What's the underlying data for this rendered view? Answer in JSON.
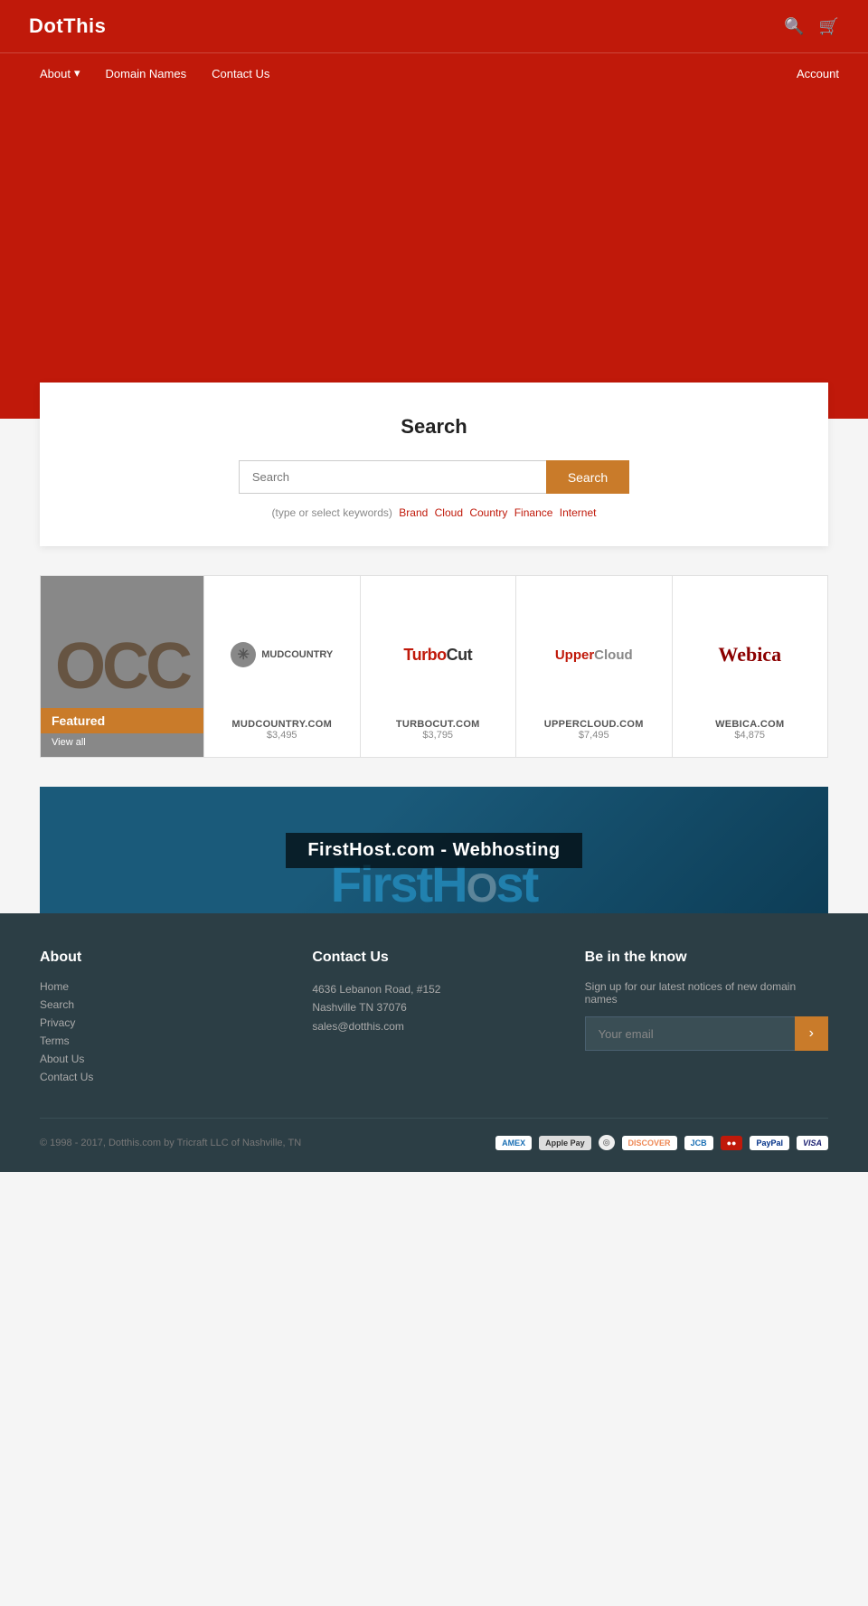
{
  "header": {
    "logo": "DotThis",
    "nav": {
      "about": "About",
      "domain_names": "Domain Names",
      "contact_us": "Contact Us",
      "account": "Account"
    }
  },
  "search": {
    "title": "Search",
    "placeholder": "Search",
    "button_label": "Search",
    "tags_prefix": "(type or select keywords)",
    "tags": [
      "Brand",
      "Cloud",
      "Country",
      "Finance",
      "Internet"
    ]
  },
  "featured": {
    "label": "Featured",
    "view_all": "View all",
    "domains": [
      {
        "name": "MUDCOUNTRY.COM",
        "price": "$3,495",
        "logo_type": "mudcountry"
      },
      {
        "name": "TURBOCUT.COM",
        "price": "$3,795",
        "logo_type": "turbocut"
      },
      {
        "name": "UPPERCLOUD.COM",
        "price": "$7,495",
        "logo_type": "uppercloud"
      },
      {
        "name": "WEBICA.COM",
        "price": "$4,875",
        "logo_type": "webica"
      }
    ]
  },
  "banner": {
    "title": "FirstHost.com - Webhosting",
    "logo_text": "FirstHOst"
  },
  "footer": {
    "about_heading": "About",
    "about_links": [
      "Home",
      "Search",
      "Privacy",
      "Terms",
      "About Us",
      "Contact Us"
    ],
    "contact_heading": "Contact Us",
    "address_line1": "4636 Lebanon Road, #152",
    "address_line2": "Nashville TN 37076",
    "email": "sales@dotthis.com",
    "newsletter_heading": "Be in the know",
    "newsletter_sub": "Sign up for our latest notices of new domain names",
    "email_placeholder": "Your email",
    "subscribe_icon": "›",
    "copyright": "© 1998 - 2017, Dotthis.com by Tricraft LLC of Nashville, TN",
    "payment_methods": [
      "AMEX",
      "Apple Pay",
      "◎",
      "DISCOVER",
      "JCB",
      "●●",
      "PayPal",
      "VISA"
    ]
  }
}
